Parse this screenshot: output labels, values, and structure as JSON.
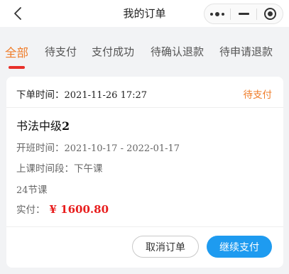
{
  "navbar": {
    "title": "我的订单",
    "back_icon": "chevron-left-icon",
    "capsule_icons": [
      "more-dots-icon",
      "minimize-icon",
      "close-target-icon"
    ]
  },
  "tabs": [
    {
      "label": "全部",
      "active": true
    },
    {
      "label": "待支付",
      "active": false
    },
    {
      "label": "支付成功",
      "active": false
    },
    {
      "label": "待确认退款",
      "active": false
    },
    {
      "label": "待申请退款",
      "active": false
    }
  ],
  "order": {
    "time_label": "下单时间：",
    "time_value": "2021-11-26 17:27",
    "status": "待支付",
    "course_prefix": "书法中级",
    "course_suffix": "2",
    "class_time_label": "开班时间：",
    "class_time_value": "2021-10-17 - 2022-01-17",
    "period_label": "上课时间段：",
    "period_value": "下午课",
    "lessons_count": "24",
    "lessons_unit": "节课",
    "paid_label": "实付：",
    "paid_value": "¥ 1600.80",
    "cancel_button": "取消订单",
    "pay_button": "继续支付"
  },
  "colors": {
    "accent": "#ef7d2a",
    "indicator": "#e8302a",
    "price": "#e81d1d",
    "primary_button": "#1e9bf0",
    "background": "#f2f3f5"
  }
}
